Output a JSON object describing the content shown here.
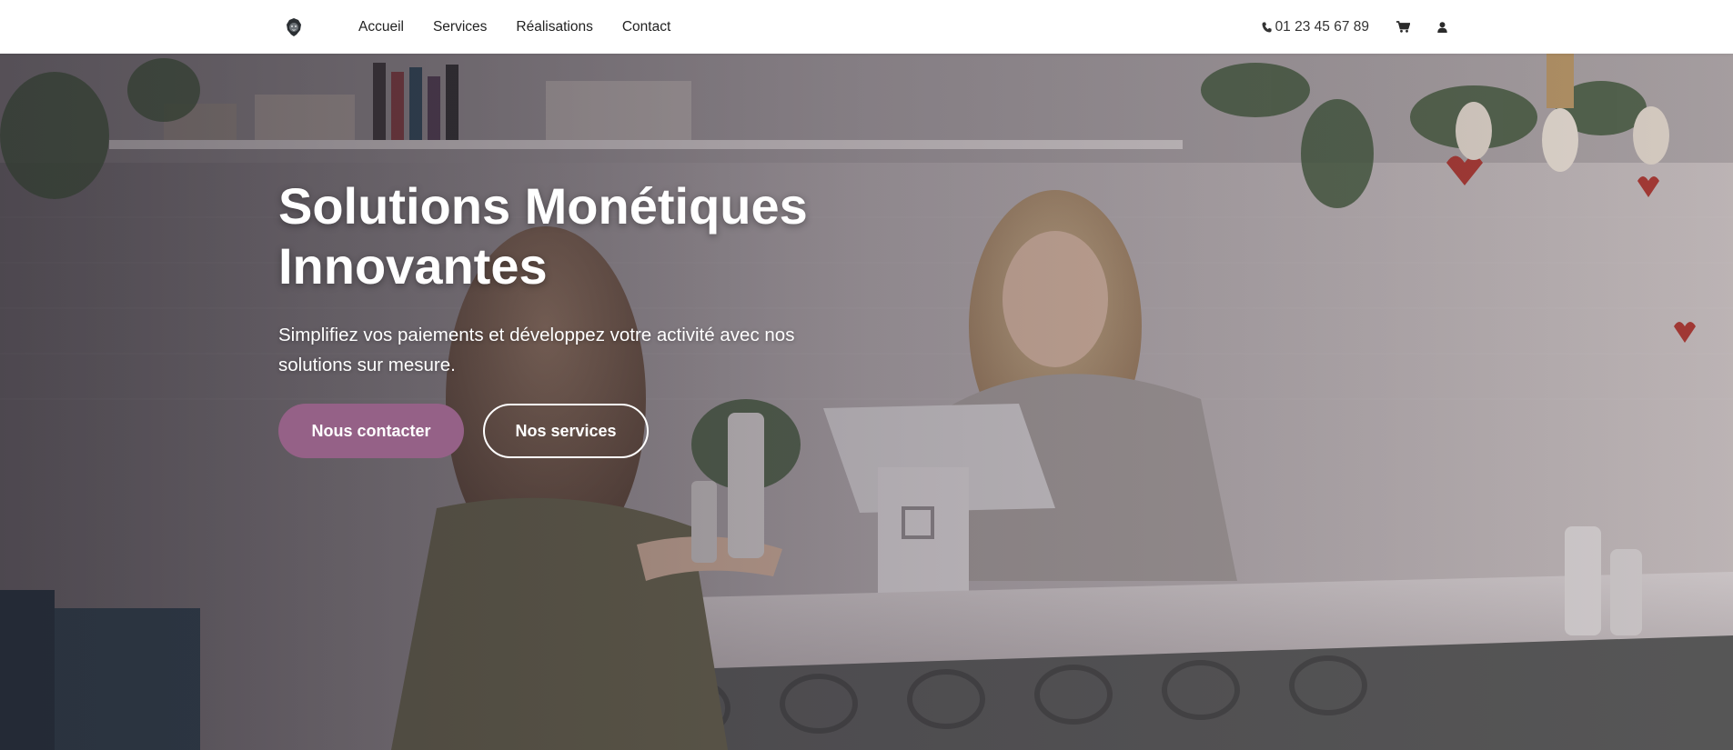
{
  "header": {
    "logo_icon": "lion-head-icon",
    "nav": [
      {
        "label": "Accueil"
      },
      {
        "label": "Services"
      },
      {
        "label": "Réalisations"
      },
      {
        "label": "Contact"
      }
    ],
    "phone": "01 23 45 67 89",
    "phone_icon": "phone-icon",
    "cart_icon": "cart-icon",
    "user_icon": "user-icon"
  },
  "hero": {
    "title_line1": "Solutions Monétiques",
    "title_line2": "Innovantes",
    "subtitle": "Simplifiez vos paiements et développez votre activité avec nos solutions sur mesure.",
    "primary_button": "Nous contacter",
    "secondary_button": "Nos services",
    "colors": {
      "accent": "#956187",
      "text": "#ffffff"
    }
  }
}
